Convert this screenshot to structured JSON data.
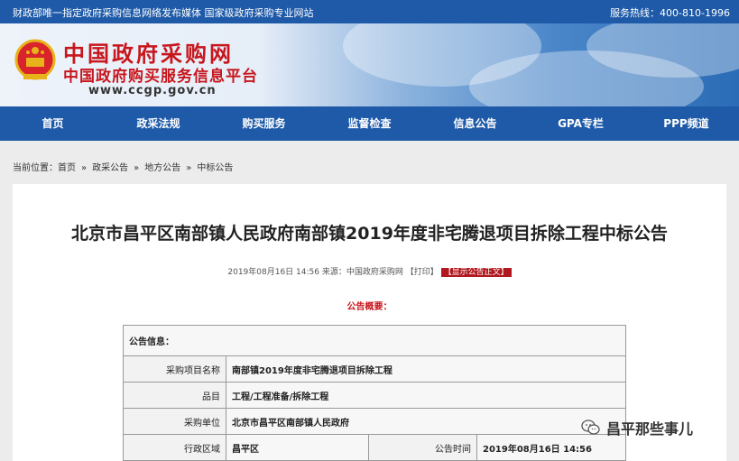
{
  "topbar": {
    "left_text": "财政部唯一指定政府采购信息网络发布媒体  国家级政府采购专业网站",
    "hotline": "服务热线：400-810-1996"
  },
  "logo": {
    "title": "中国政府采购网",
    "subtitle": "中国政府购买服务信息平台",
    "url": "www.ccgp.gov.cn"
  },
  "nav": [
    "首页",
    "政采法规",
    "购买服务",
    "监督检查",
    "信息公告",
    "GPA专栏",
    "PPP频道"
  ],
  "breadcrumb": {
    "prefix": "当前位置：",
    "items": [
      "首页",
      "»",
      "政采公告",
      "»",
      "地方公告",
      "»",
      "中标公告"
    ]
  },
  "article": {
    "title": "北京市昌平区南部镇人民政府南部镇2019年度非宅腾退项目拆除工程中标公告",
    "meta": "2019年08月16日 14:56 来源：中国政府采购网 【打印】",
    "show_body": "【显示公告正文】",
    "summary": "公告概要："
  },
  "table": {
    "header": "公告信息：",
    "rows": [
      {
        "label": "采购项目名称",
        "value": "南部镇2019年度非宅腾退项目拆除工程"
      },
      {
        "label": "品目",
        "value": "工程/工程准备/拆除工程"
      },
      {
        "label": "采购单位",
        "value": "北京市昌平区南部镇人民政府"
      }
    ],
    "last_row": {
      "label": "行政区域",
      "value": "昌平区",
      "label2": "公告时间",
      "value2": "2019年08月16日  14:56"
    }
  },
  "watermark": "昌平那些事儿"
}
